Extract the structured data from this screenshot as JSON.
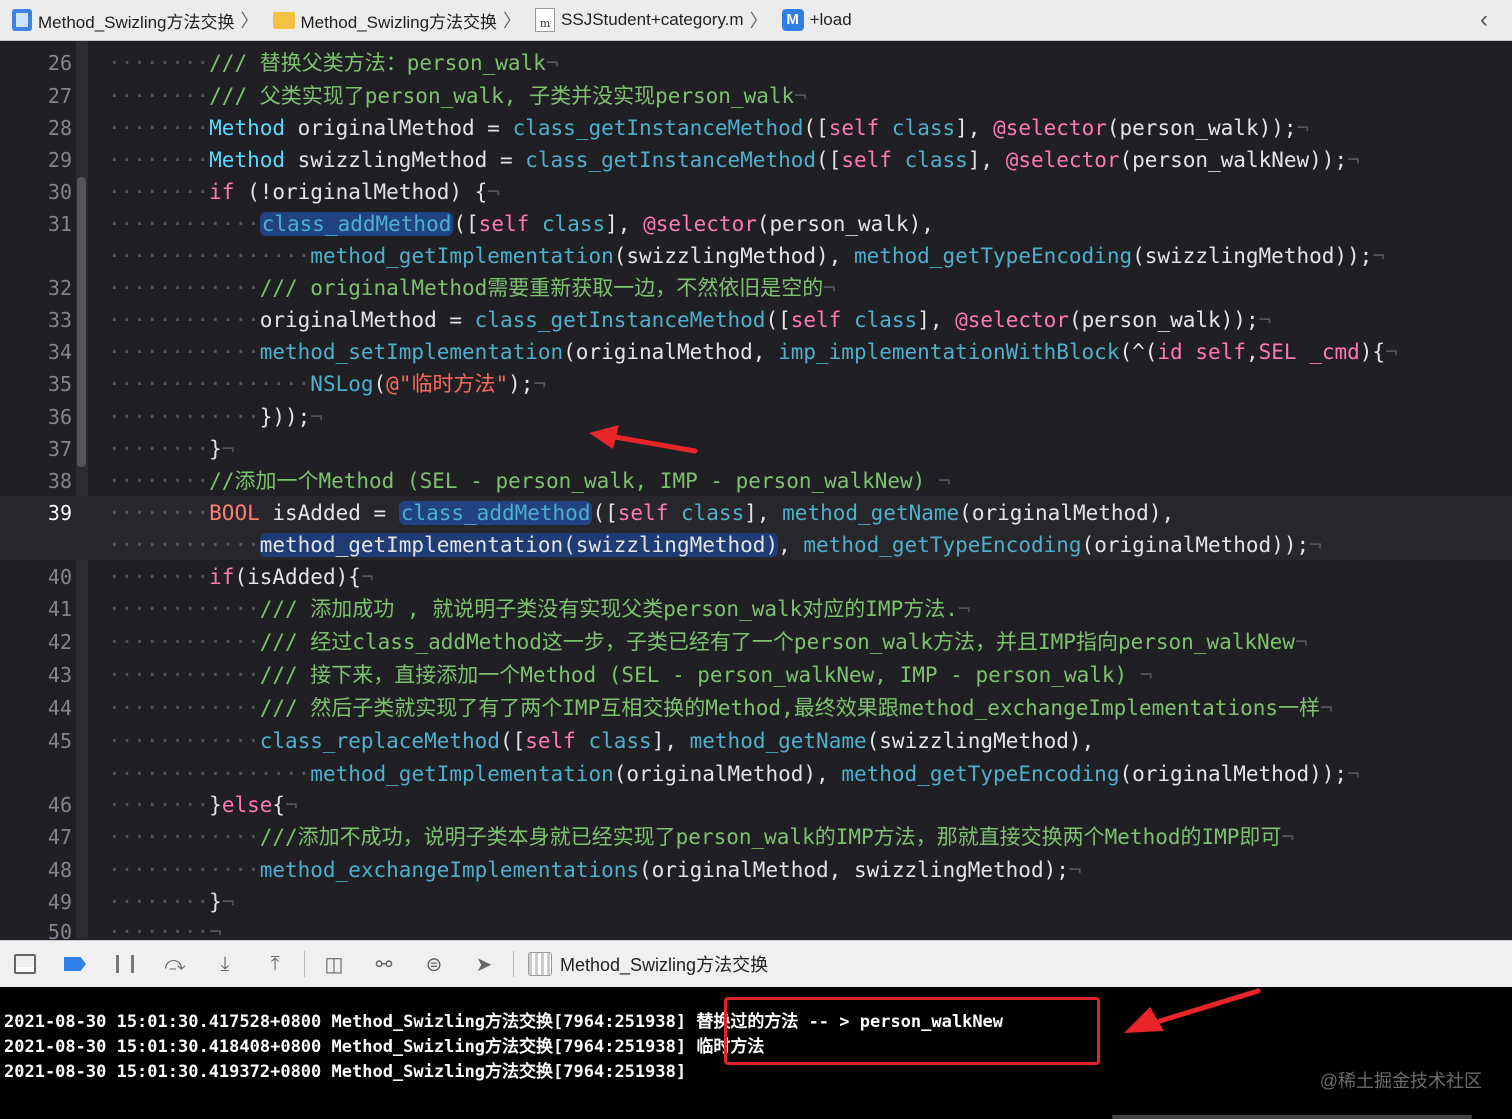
{
  "breadcrumbs": [
    {
      "icon": "project-icon",
      "label": "Method_Swizling方法交换"
    },
    {
      "icon": "folder-icon",
      "label": "Method_Swizling方法交换"
    },
    {
      "icon": "m-file-icon",
      "label": "SSJStudent+category.m",
      "icon_text": "m"
    },
    {
      "icon": "method-icon",
      "label": "+load",
      "icon_text": "M"
    }
  ],
  "breadcrumb_separator": "〉",
  "back_glyph": "‹",
  "current_line": "39",
  "code_lines": [
    {
      "num": "26",
      "parts": [
        [
          "dots",
          "········"
        ],
        [
          "cm",
          "/// 替换父类方法：person_walk"
        ],
        [
          "dots",
          "¬"
        ]
      ]
    },
    {
      "num": "27",
      "parts": [
        [
          "dots",
          "········"
        ],
        [
          "cm",
          "/// 父类实现了person_walk, 子类并没实现person_walk"
        ],
        [
          "dots",
          "¬"
        ]
      ]
    },
    {
      "num": "28",
      "parts": [
        [
          "dots",
          "········"
        ],
        [
          "type",
          "Method"
        ],
        [
          "p",
          " originalMethod = "
        ],
        [
          "fn",
          "class_getInstanceMethod"
        ],
        [
          "p",
          "(["
        ],
        [
          "kw",
          "self"
        ],
        [
          "p",
          " "
        ],
        [
          "fn",
          "class"
        ],
        [
          "p",
          "], "
        ],
        [
          "kw",
          "@selector"
        ],
        [
          "p",
          "(person_walk));"
        ],
        [
          "dots",
          "¬"
        ]
      ]
    },
    {
      "num": "29",
      "parts": [
        [
          "dots",
          "········"
        ],
        [
          "type",
          "Method"
        ],
        [
          "p",
          " swizzlingMethod = "
        ],
        [
          "fn",
          "class_getInstanceMethod"
        ],
        [
          "p",
          "(["
        ],
        [
          "kw",
          "self"
        ],
        [
          "p",
          " "
        ],
        [
          "fn",
          "class"
        ],
        [
          "p",
          "], "
        ],
        [
          "kw",
          "@selector"
        ],
        [
          "p",
          "(person_walkNew));"
        ],
        [
          "dots",
          "¬"
        ]
      ]
    },
    {
      "num": "30",
      "parts": [
        [
          "dots",
          "········"
        ],
        [
          "kw",
          "if"
        ],
        [
          "p",
          " (!originalMethod) {"
        ],
        [
          "dots",
          "¬"
        ]
      ]
    },
    {
      "num": "31",
      "parts": [
        [
          "dots",
          "············"
        ],
        [
          "fnhl",
          "class_addMethod"
        ],
        [
          "p",
          "(["
        ],
        [
          "kw",
          "self"
        ],
        [
          "p",
          " "
        ],
        [
          "fn",
          "class"
        ],
        [
          "p",
          "], "
        ],
        [
          "kw",
          "@selector"
        ],
        [
          "p",
          "(person_walk),"
        ]
      ]
    },
    {
      "num": "",
      "parts": [
        [
          "dots",
          "················"
        ],
        [
          "fn",
          "method_getImplementation"
        ],
        [
          "p",
          "(swizzlingMethod), "
        ],
        [
          "fn",
          "method_getTypeEncoding"
        ],
        [
          "p",
          "(swizzlingMethod));"
        ],
        [
          "dots",
          "¬"
        ]
      ]
    },
    {
      "num": "32",
      "parts": [
        [
          "dots",
          "············"
        ],
        [
          "cm",
          "/// originalMethod需要重新获取一边，不然依旧是空的"
        ],
        [
          "dots",
          "¬"
        ]
      ]
    },
    {
      "num": "33",
      "parts": [
        [
          "dots",
          "············"
        ],
        [
          "p",
          "originalMethod = "
        ],
        [
          "fn",
          "class_getInstanceMethod"
        ],
        [
          "p",
          "(["
        ],
        [
          "kw",
          "self"
        ],
        [
          "p",
          " "
        ],
        [
          "fn",
          "class"
        ],
        [
          "p",
          "], "
        ],
        [
          "kw",
          "@selector"
        ],
        [
          "p",
          "(person_walk));"
        ],
        [
          "dots",
          "¬"
        ]
      ]
    },
    {
      "num": "34",
      "parts": [
        [
          "dots",
          "············"
        ],
        [
          "fn",
          "method_setImplementation"
        ],
        [
          "p",
          "(originalMethod, "
        ],
        [
          "fn",
          "imp_implementationWithBlock"
        ],
        [
          "p",
          "(^("
        ],
        [
          "kw",
          "id"
        ],
        [
          "p",
          " "
        ],
        [
          "kw",
          "self"
        ],
        [
          "p",
          ","
        ],
        [
          "kw",
          "SEL"
        ],
        [
          "p",
          " "
        ],
        [
          "kw",
          "_cmd"
        ],
        [
          "p",
          "){"
        ],
        [
          "dots",
          "¬"
        ]
      ]
    },
    {
      "num": "35",
      "parts": [
        [
          "dots",
          "················"
        ],
        [
          "fn",
          "NSLog"
        ],
        [
          "p",
          "("
        ],
        [
          "sl",
          "@\"临时方法\""
        ],
        [
          "p",
          ");"
        ],
        [
          "dots",
          "¬"
        ]
      ]
    },
    {
      "num": "36",
      "parts": [
        [
          "dots",
          "············"
        ],
        [
          "p",
          "}));"
        ],
        [
          "dots",
          "¬"
        ]
      ]
    },
    {
      "num": "37",
      "parts": [
        [
          "dots",
          "········"
        ],
        [
          "p",
          "}"
        ],
        [
          "dots",
          "¬"
        ]
      ]
    },
    {
      "num": "38",
      "parts": [
        [
          "dots",
          "········"
        ],
        [
          "cm",
          "//添加一个Method (SEL - person_walk, IMP - person_walkNew)"
        ],
        [
          "dots",
          " ¬"
        ]
      ]
    },
    {
      "num": "39",
      "parts": [
        [
          "dots",
          "········"
        ],
        [
          "bool",
          "BOOL"
        ],
        [
          "p",
          " isAdded = "
        ],
        [
          "fnhl",
          "class_addMethod"
        ],
        [
          "p",
          "(["
        ],
        [
          "kw",
          "self"
        ],
        [
          "p",
          " "
        ],
        [
          "fn",
          "class"
        ],
        [
          "p",
          "], "
        ],
        [
          "fn",
          "method_getName"
        ],
        [
          "p",
          "(originalMethod),"
        ]
      ]
    },
    {
      "num": "",
      "parts": [
        [
          "dots",
          "············"
        ],
        [
          "hl2",
          "method_getImplementation(swizzlingMethod)"
        ],
        [
          "p",
          ", "
        ],
        [
          "fn",
          "method_getTypeEncoding"
        ],
        [
          "p",
          "(originalMethod));"
        ],
        [
          "dots",
          "¬"
        ]
      ]
    },
    {
      "num": "40",
      "parts": [
        [
          "dots",
          "········"
        ],
        [
          "kw",
          "if"
        ],
        [
          "p",
          "(isAdded){"
        ],
        [
          "dots",
          "¬"
        ]
      ]
    },
    {
      "num": "41",
      "parts": [
        [
          "dots",
          "············"
        ],
        [
          "cm",
          "/// 添加成功 , 就说明子类没有实现父类person_walk对应的IMP方法."
        ],
        [
          "dots",
          "¬"
        ]
      ]
    },
    {
      "num": "42",
      "parts": [
        [
          "dots",
          "············"
        ],
        [
          "cm",
          "/// 经过class_addMethod这一步，子类已经有了一个person_walk方法，并且IMP指向person_walkNew"
        ],
        [
          "dots",
          "¬"
        ]
      ]
    },
    {
      "num": "43",
      "parts": [
        [
          "dots",
          "············"
        ],
        [
          "cm",
          "/// 接下来，直接添加一个Method (SEL - person_walkNew, IMP - person_walk)"
        ],
        [
          "dots",
          " ¬"
        ]
      ]
    },
    {
      "num": "44",
      "parts": [
        [
          "dots",
          "············"
        ],
        [
          "cm",
          "/// 然后子类就实现了有了两个IMP互相交换的Method,最终效果跟method_exchangeImplementations一样"
        ],
        [
          "dots",
          "¬"
        ]
      ]
    },
    {
      "num": "45",
      "parts": [
        [
          "dots",
          "············"
        ],
        [
          "fn",
          "class_replaceMethod"
        ],
        [
          "p",
          "(["
        ],
        [
          "kw",
          "self"
        ],
        [
          "p",
          " "
        ],
        [
          "fn",
          "class"
        ],
        [
          "p",
          "], "
        ],
        [
          "fn",
          "method_getName"
        ],
        [
          "p",
          "(swizzlingMethod),"
        ]
      ]
    },
    {
      "num": "",
      "parts": [
        [
          "dots",
          "················"
        ],
        [
          "fn",
          "method_getImplementation"
        ],
        [
          "p",
          "(originalMethod), "
        ],
        [
          "fn",
          "method_getTypeEncoding"
        ],
        [
          "p",
          "(originalMethod));"
        ],
        [
          "dots",
          "¬"
        ]
      ]
    },
    {
      "num": "46",
      "parts": [
        [
          "dots",
          "········"
        ],
        [
          "p",
          "}"
        ],
        [
          "kw",
          "else"
        ],
        [
          "p",
          "{"
        ],
        [
          "dots",
          "¬"
        ]
      ]
    },
    {
      "num": "47",
      "parts": [
        [
          "dots",
          "············"
        ],
        [
          "cm",
          "///添加不成功，说明子类本身就已经实现了person_walk的IMP方法，那就直接交换两个Method的IMP即可"
        ],
        [
          "dots",
          "¬"
        ]
      ]
    },
    {
      "num": "48",
      "parts": [
        [
          "dots",
          "············"
        ],
        [
          "fn",
          "method_exchangeImplementations"
        ],
        [
          "p",
          "(originalMethod, swizzlingMethod);"
        ],
        [
          "dots",
          "¬"
        ]
      ]
    },
    {
      "num": "49",
      "parts": [
        [
          "dots",
          "········"
        ],
        [
          "p",
          "}"
        ],
        [
          "dots",
          "¬"
        ]
      ]
    },
    {
      "num": "50",
      "parts": [
        [
          "dots",
          "········"
        ],
        [
          "dots",
          "¬"
        ]
      ]
    }
  ],
  "debug_bar": {
    "process_name": "Method_Swizling方法交换",
    "buttons": [
      "hide-console-icon",
      "breakpoints-icon",
      "pause-icon",
      "step-over-icon",
      "step-into-icon",
      "step-out-icon",
      "view-hierarchy-icon",
      "memory-graph-icon",
      "environment-icon",
      "location-icon"
    ]
  },
  "console": {
    "lines": [
      {
        "prefix": "2021-08-30 15:01:30.417528+0800 Method_Swizling方法交换[7964:251938]",
        "message": " 替换过的方法 -- > person_walkNew"
      },
      {
        "prefix": "2021-08-30 15:01:30.418408+0800 Method_Swizling方法交换[7964:251938]",
        "message": " 临时方法"
      },
      {
        "prefix": "2021-08-30 15:01:30.419372+0800 Method_Swizling方法交换[7964:251938]",
        "message": ""
      }
    ],
    "watermark": "@稀土掘金技术社区"
  },
  "colors": {
    "annotation": "#e0222a",
    "keyword": "#ff7ab2",
    "function": "#4eb0cc",
    "comment": "#7ec16f",
    "string": "#fc6a5d"
  }
}
